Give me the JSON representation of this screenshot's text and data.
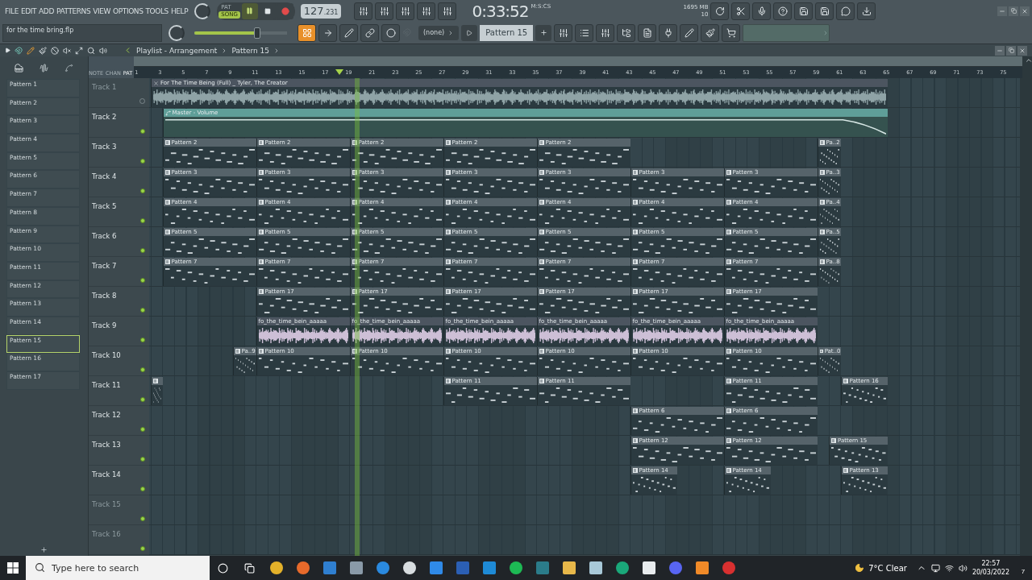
{
  "menu": [
    "FILE",
    "EDIT",
    "ADD",
    "PATTERNS",
    "VIEW",
    "OPTIONS",
    "TOOLS",
    "HELP"
  ],
  "hint": "for the time bring.flp",
  "transport": {
    "modes": [
      {
        "label": "PAT",
        "selected": false
      },
      {
        "label": "SONG",
        "selected": true
      }
    ],
    "tempo": "127",
    "tempo_fraction": ".231",
    "time_format": "M:S:CS",
    "time": "0:33:52",
    "memory": "1695 MB",
    "cpu": "10",
    "master_volume": {
      "level": 0.68
    }
  },
  "snap": "(none)",
  "pattern_selector": "Pattern 15",
  "playlist": {
    "title": "Playlist - Arrangement",
    "crumb": "Pattern 15",
    "view_tabs": [
      {
        "label": "NOTE",
        "selected": false
      },
      {
        "label": "CHAN",
        "selected": false
      },
      {
        "label": "PAT",
        "selected": true
      }
    ],
    "ruler": [
      "1",
      "3",
      "5",
      "7",
      "9",
      "11",
      "13",
      "15",
      "17",
      "19",
      "21",
      "23",
      "25",
      "27",
      "29",
      "31",
      "33",
      "35",
      "37",
      "39",
      "41",
      "43",
      "45",
      "47",
      "49",
      "51",
      "53",
      "55",
      "57",
      "59",
      "61",
      "63",
      "65",
      "67",
      "69",
      "71",
      "73",
      "75"
    ],
    "patterns": [
      {
        "name": "Pattern 1",
        "selected": false
      },
      {
        "name": "Pattern 2",
        "selected": false
      },
      {
        "name": "Pattern 3",
        "selected": false
      },
      {
        "name": "Pattern 4",
        "selected": false
      },
      {
        "name": "Pattern 5",
        "selected": false
      },
      {
        "name": "Pattern 6",
        "selected": false
      },
      {
        "name": "Pattern 7",
        "selected": false
      },
      {
        "name": "Pattern 8",
        "selected": false
      },
      {
        "name": "Pattern 9",
        "selected": false
      },
      {
        "name": "Pattern 10",
        "selected": false
      },
      {
        "name": "Pattern 11",
        "selected": false
      },
      {
        "name": "Pattern 12",
        "selected": false
      },
      {
        "name": "Pattern 13",
        "selected": false
      },
      {
        "name": "Pattern 14",
        "selected": false
      },
      {
        "name": "Pattern 15",
        "selected": true
      },
      {
        "name": "Pattern 16",
        "selected": false
      },
      {
        "name": "Pattern 17",
        "selected": false
      }
    ],
    "tracks": [
      {
        "name": "Track 1",
        "dimmed": true,
        "clips": [
          {
            "kind": "audio",
            "label": "For The Time Being (Full) _ Tyler, The Creator",
            "color": "#8fa3a6"
          }
        ]
      },
      {
        "name": "Track 2",
        "dimmed": false,
        "clips": [
          {
            "kind": "automation",
            "label": "Master - Volume"
          }
        ]
      },
      {
        "name": "Track 3",
        "dimmed": false,
        "clips": [
          {
            "kind": "pattern",
            "label": "Pattern 2"
          },
          {
            "kind": "pattern",
            "label": "Pattern 2"
          },
          {
            "kind": "pattern",
            "label": "Pattern 2"
          },
          {
            "kind": "pattern",
            "label": "Pattern 2"
          },
          {
            "kind": "pattern",
            "label": "Pattern 2"
          },
          {
            "kind": "pattern",
            "label": "Pa..2"
          }
        ]
      },
      {
        "name": "Track 4",
        "dimmed": false,
        "clips": [
          {
            "kind": "pattern",
            "label": "Pattern 3"
          },
          {
            "kind": "pattern",
            "label": "Pattern 3"
          },
          {
            "kind": "pattern",
            "label": "Pattern 3"
          },
          {
            "kind": "pattern",
            "label": "Pattern 3"
          },
          {
            "kind": "pattern",
            "label": "Pattern 3"
          },
          {
            "kind": "pattern",
            "label": "Pattern 3"
          },
          {
            "kind": "pattern",
            "label": "Pattern 3"
          },
          {
            "kind": "pattern",
            "label": "Pa..3"
          }
        ]
      },
      {
        "name": "Track 5",
        "dimmed": false,
        "clips": [
          {
            "kind": "pattern",
            "label": "Pattern 4"
          },
          {
            "kind": "pattern",
            "label": "Pattern 4"
          },
          {
            "kind": "pattern",
            "label": "Pattern 4"
          },
          {
            "kind": "pattern",
            "label": "Pattern 4"
          },
          {
            "kind": "pattern",
            "label": "Pattern 4"
          },
          {
            "kind": "pattern",
            "label": "Pattern 4"
          },
          {
            "kind": "pattern",
            "label": "Pattern 4"
          },
          {
            "kind": "pattern",
            "label": "Pa..4"
          }
        ]
      },
      {
        "name": "Track 6",
        "dimmed": false,
        "clips": [
          {
            "kind": "pattern",
            "label": "Pattern 5"
          },
          {
            "kind": "pattern",
            "label": "Pattern 5"
          },
          {
            "kind": "pattern",
            "label": "Pattern 5"
          },
          {
            "kind": "pattern",
            "label": "Pattern 5"
          },
          {
            "kind": "pattern",
            "label": "Pattern 5"
          },
          {
            "kind": "pattern",
            "label": "Pattern 5"
          },
          {
            "kind": "pattern",
            "label": "Pattern 5"
          },
          {
            "kind": "pattern",
            "label": "Pa..5"
          }
        ]
      },
      {
        "name": "Track 7",
        "dimmed": false,
        "clips": [
          {
            "kind": "pattern",
            "label": "Pattern 7"
          },
          {
            "kind": "pattern",
            "label": "Pattern 7"
          },
          {
            "kind": "pattern",
            "label": "Pattern 7"
          },
          {
            "kind": "pattern",
            "label": "Pattern 7"
          },
          {
            "kind": "pattern",
            "label": "Pattern 7"
          },
          {
            "kind": "pattern",
            "label": "Pattern 7"
          },
          {
            "kind": "pattern",
            "label": "Pattern 7"
          },
          {
            "kind": "pattern",
            "label": "Pa..8"
          }
        ]
      },
      {
        "name": "Track 8",
        "dimmed": false,
        "clips": [
          {
            "kind": "pattern",
            "label": "Pattern 17"
          },
          {
            "kind": "pattern",
            "label": "Pattern 17"
          },
          {
            "kind": "pattern",
            "label": "Pattern 17"
          },
          {
            "kind": "pattern",
            "label": "Pattern 17"
          },
          {
            "kind": "pattern",
            "label": "Pattern 17"
          },
          {
            "kind": "pattern",
            "label": "Pattern 17"
          }
        ]
      },
      {
        "name": "Track 9",
        "dimmed": false,
        "clips": [
          {
            "kind": "audio",
            "label": "fo_the_time_bein_aaaaa",
            "color": "#cdbfd6"
          },
          {
            "kind": "audio",
            "label": "fo_the_time_bein_aaaaa",
            "color": "#cdbfd6"
          },
          {
            "kind": "audio",
            "label": "fo_the_time_bein_aaaaa",
            "color": "#cdbfd6"
          },
          {
            "kind": "audio",
            "label": "fo_the_time_bein_aaaaa",
            "color": "#cdbfd6"
          },
          {
            "kind": "audio",
            "label": "fo_the_time_bein_aaaaa",
            "color": "#cdbfd6"
          },
          {
            "kind": "audio",
            "label": "fo_the_time_bein_aaaaa",
            "color": "#cdbfd6"
          }
        ]
      },
      {
        "name": "Track 10",
        "dimmed": false,
        "clips": [
          {
            "kind": "pattern",
            "label": "Pa..9"
          },
          {
            "kind": "pattern",
            "label": "Pattern 10"
          },
          {
            "kind": "pattern",
            "label": "Pattern 10"
          },
          {
            "kind": "pattern",
            "label": "Pattern 10"
          },
          {
            "kind": "pattern",
            "label": "Pattern 10"
          },
          {
            "kind": "pattern",
            "label": "Pattern 10"
          },
          {
            "kind": "pattern",
            "label": "Pattern 10"
          },
          {
            "kind": "pattern",
            "label": "Pat..0"
          }
        ]
      },
      {
        "name": "Track 11",
        "dimmed": false,
        "clips": [
          {
            "kind": "pattern"
          },
          {
            "kind": "pattern",
            "label": "Pattern 11"
          },
          {
            "kind": "pattern",
            "label": "Pattern 11"
          },
          {
            "kind": "pattern",
            "label": "Pattern 11"
          },
          {
            "kind": "pattern",
            "label": "Pattern 16"
          }
        ]
      },
      {
        "name": "Track 12",
        "dimmed": false,
        "clips": [
          {
            "kind": "pattern",
            "label": "Pattern 6"
          },
          {
            "kind": "pattern",
            "label": "Pattern 6"
          }
        ]
      },
      {
        "name": "Track 13",
        "dimmed": false,
        "clips": [
          {
            "kind": "pattern",
            "label": "Pattern 12"
          },
          {
            "kind": "pattern",
            "label": "Pattern 12"
          },
          {
            "kind": "pattern",
            "label": "Pattern 15"
          }
        ]
      },
      {
        "name": "Track 14",
        "dimmed": false,
        "clips": [
          {
            "kind": "pattern",
            "label": "Pattern 14"
          },
          {
            "kind": "pattern",
            "label": "Pattern 14"
          },
          {
            "kind": "pattern",
            "label": "Pattern 13"
          }
        ]
      },
      {
        "name": "Track 15",
        "dimmed": true
      },
      {
        "name": "Track 16",
        "dimmed": true
      }
    ]
  },
  "taskbar": {
    "search_placeholder": "Type here to search",
    "weather": "7°C Clear",
    "time": "22:57",
    "date": "20/03/2022",
    "notifications": "7"
  }
}
